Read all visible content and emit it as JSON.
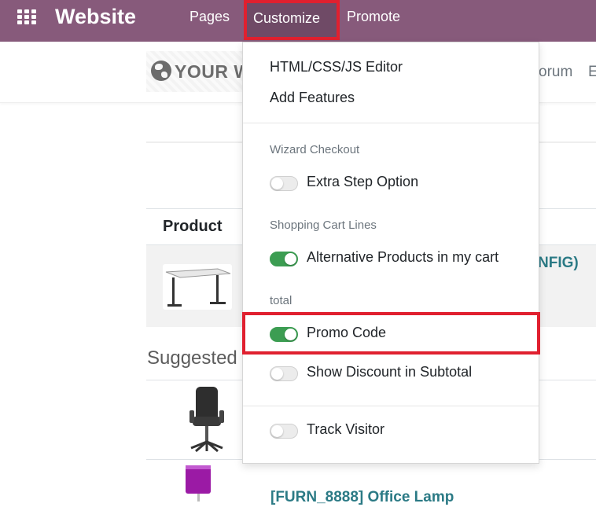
{
  "topbar": {
    "app_name": "Website",
    "menu": [
      "Pages",
      "Customize",
      "Promote"
    ],
    "active_menu": "Customize",
    "bg_color": "#875a7b"
  },
  "site_header": {
    "logo_text": "YOUR W",
    "menu_partial": [
      "orum",
      "E"
    ]
  },
  "cart": {
    "column_product": "Product",
    "row_product_partial": "NFIG)"
  },
  "suggested": {
    "title": "Suggested",
    "products": [
      "[FURN_8888] Office Lamp"
    ]
  },
  "customize_dropdown": {
    "links": [
      "HTML/CSS/JS Editor",
      "Add Features"
    ],
    "sections": [
      {
        "header": "Wizard Checkout",
        "options": [
          {
            "label": "Extra Step Option",
            "enabled": false
          }
        ]
      },
      {
        "header": "Shopping Cart Lines",
        "options": [
          {
            "label": "Alternative Products in my cart",
            "enabled": true
          }
        ]
      },
      {
        "header": "total",
        "options": [
          {
            "label": "Promo Code",
            "enabled": true,
            "highlighted": true
          },
          {
            "label": "Show Discount in Subtotal",
            "enabled": false
          }
        ]
      },
      {
        "header": "",
        "options": [
          {
            "label": "Track Visitor",
            "enabled": false
          }
        ]
      }
    ]
  },
  "colors": {
    "highlight": "#e0202f",
    "toggle_on": "#3c9d52",
    "link": "#2b7a85"
  }
}
